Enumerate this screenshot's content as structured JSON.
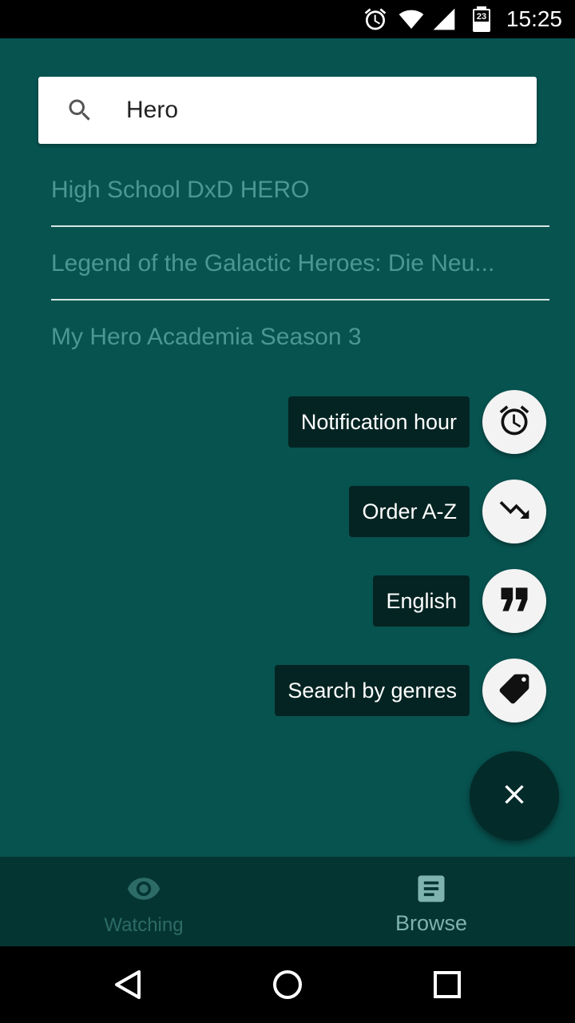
{
  "status_bar": {
    "time": "15:25",
    "battery_level": "23",
    "icons": [
      "alarm-icon",
      "wifi-icon",
      "signal-icon",
      "battery-icon"
    ]
  },
  "search": {
    "value": "Hero",
    "icon": "search-icon"
  },
  "suggestions": [
    "High School DxD HERO",
    "Legend of the Galactic Heroes: Die Neu...",
    "My Hero Academia Season 3"
  ],
  "speed_dial": {
    "items": [
      {
        "label": "Notification hour",
        "icon": "alarm-icon"
      },
      {
        "label": "Order A-Z",
        "icon": "trending-down-icon"
      },
      {
        "label": "English",
        "icon": "quote-icon"
      },
      {
        "label": "Search by genres",
        "icon": "tag-icon"
      }
    ],
    "close_icon": "close-icon"
  },
  "bottom_nav": {
    "watching": {
      "label": "Watching",
      "icon": "eye-icon"
    },
    "browse": {
      "label": "Browse",
      "icon": "document-icon"
    }
  },
  "colors": {
    "background": "#075350",
    "bottom_nav": "#043532",
    "label_bg": "#032422",
    "suggestion_text": "#4a9893",
    "active_nav": "#7fb3af",
    "inactive_nav": "#2d6b67"
  }
}
